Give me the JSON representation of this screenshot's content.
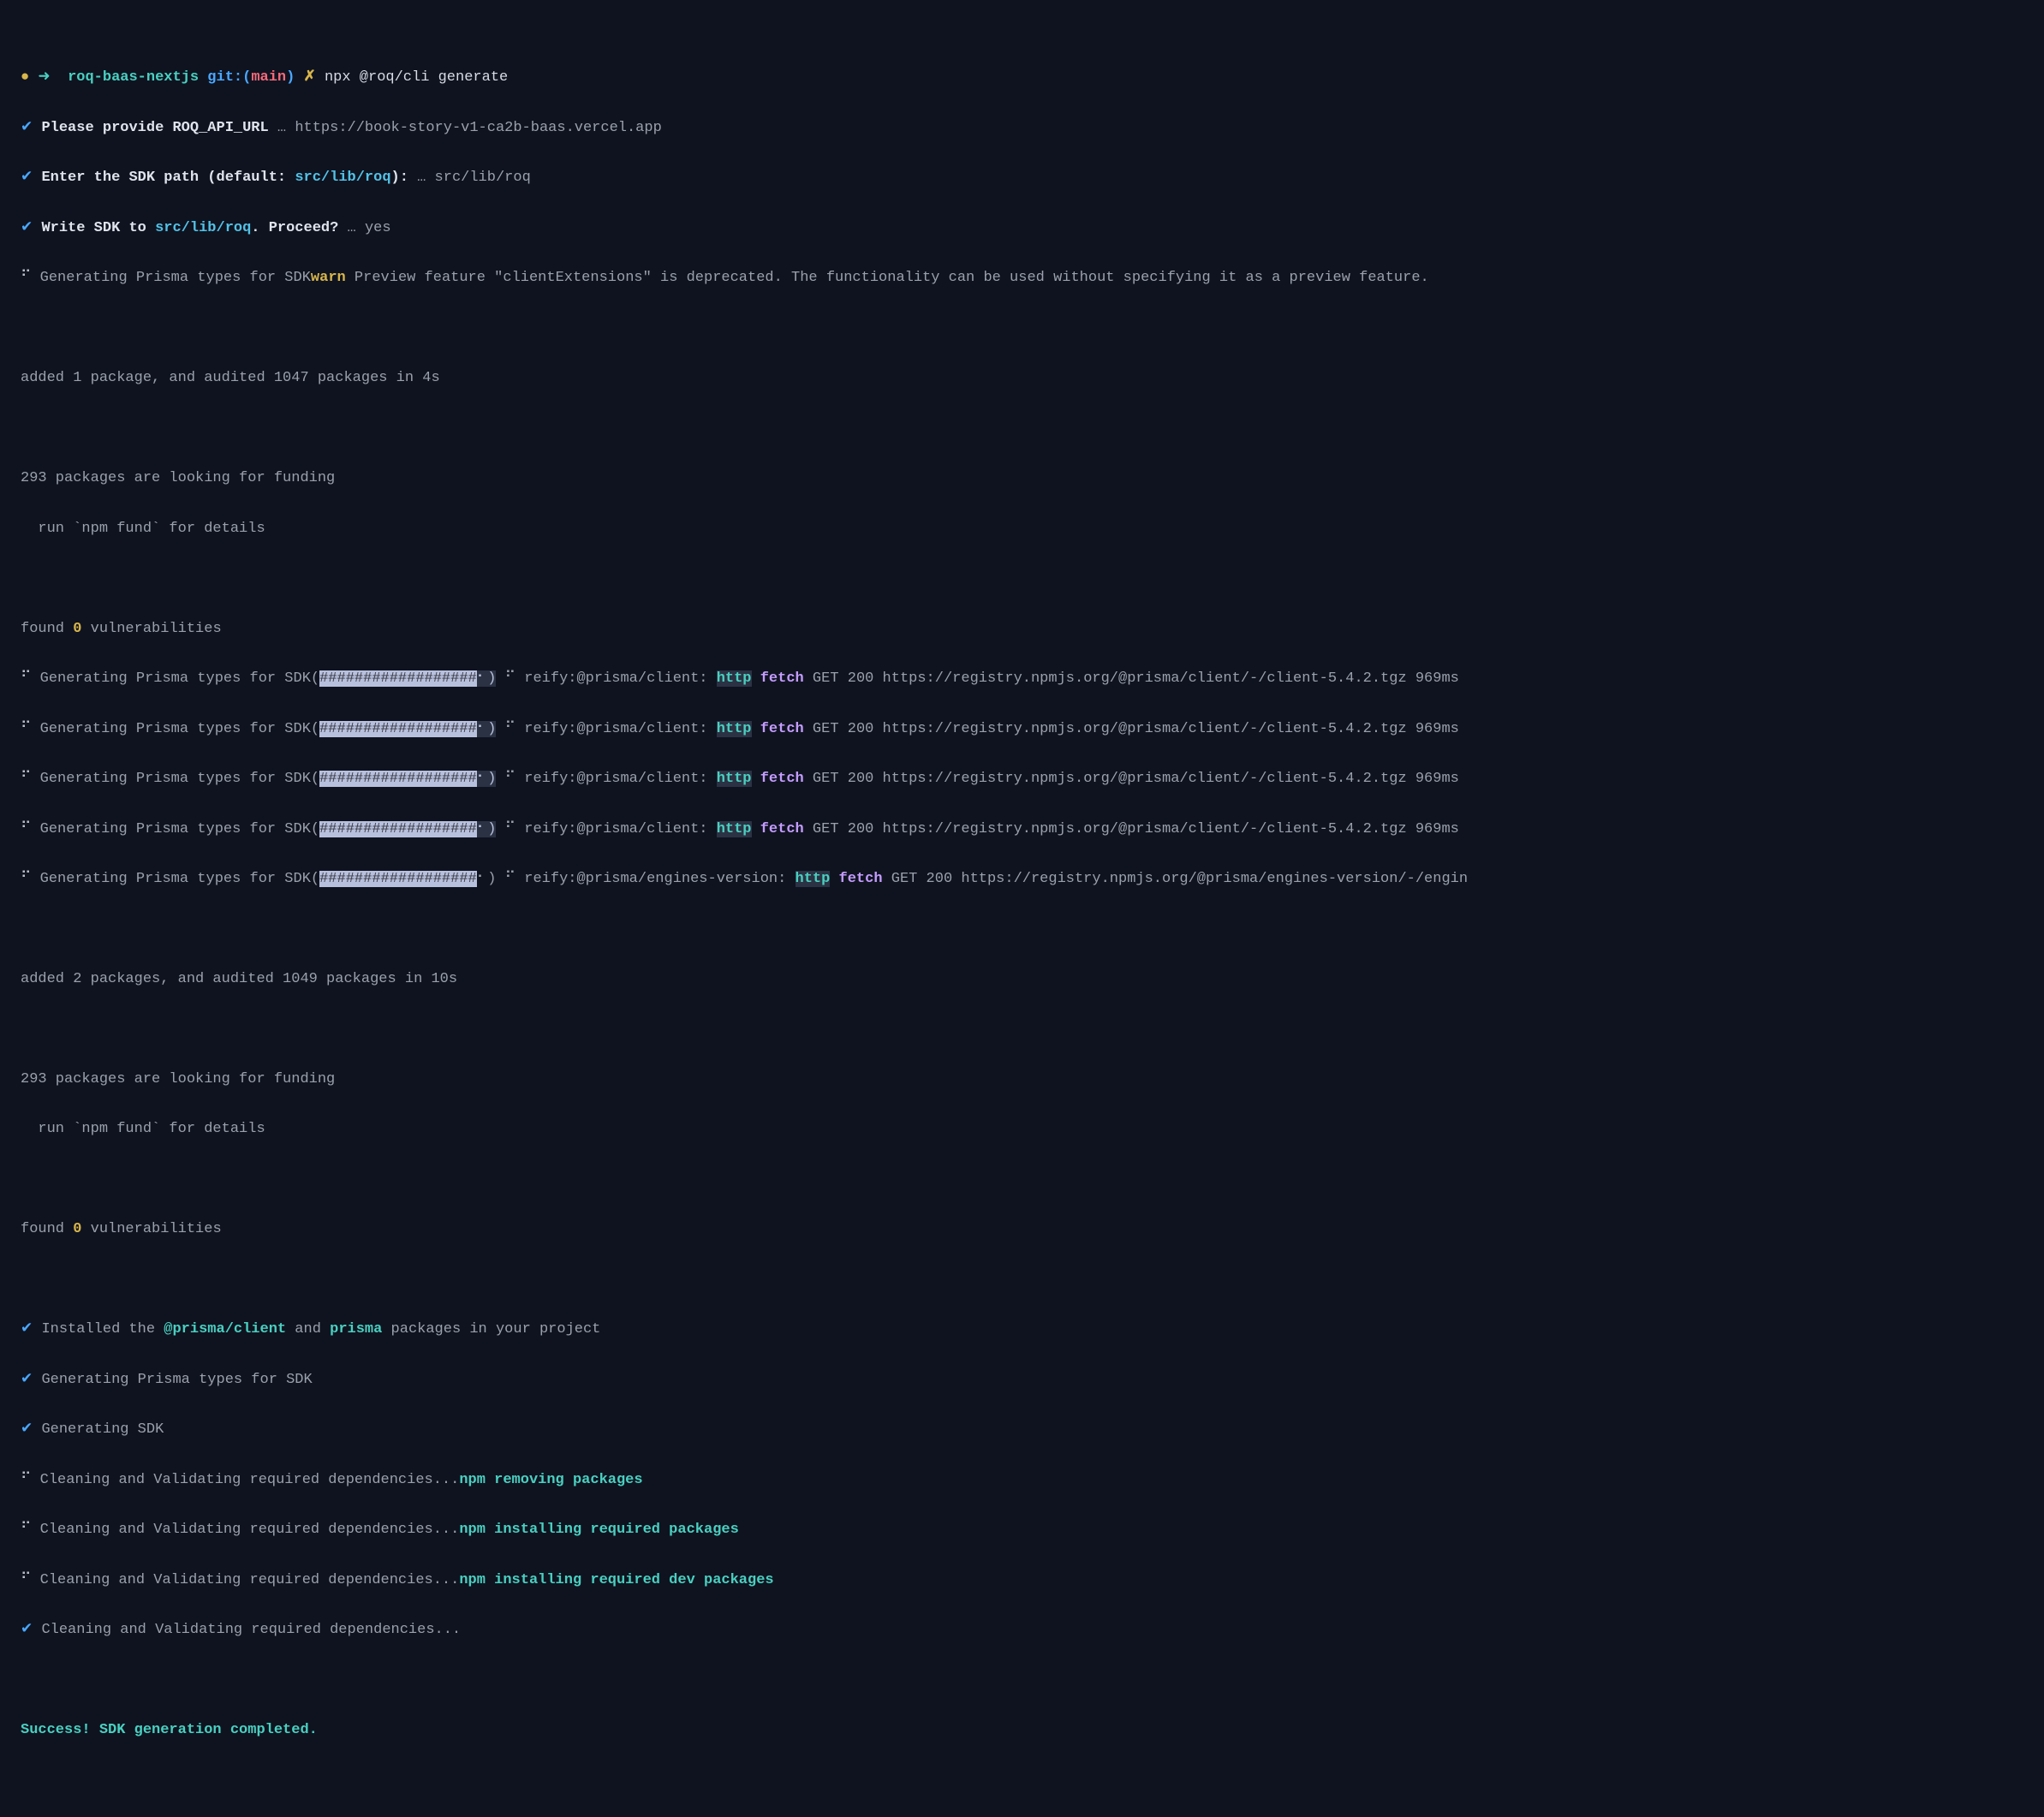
{
  "prompt": {
    "dot": "●",
    "arrow": "➜",
    "dir": "roq-baas-nextjs",
    "git": "git:",
    "lp": "(",
    "branch": "main",
    "rp": ")",
    "x": "✗",
    "cmd": "npx @roq/cli generate"
  },
  "q1": {
    "check": "✔",
    "label": "Please provide ROQ_API_URL",
    "sep": " … ",
    "val": "https://book-story-v1-ca2b-baas.vercel.app"
  },
  "q2": {
    "check": "✔",
    "label_a": "Enter the SDK path (default: ",
    "label_b": "src/lib/roq",
    "label_c": "):",
    "sep": " … ",
    "val": "src/lib/roq"
  },
  "q3": {
    "check": "✔",
    "label_a": "Write SDK to ",
    "label_b": "src/lib/roq",
    "label_c": ". Proceed?",
    "sep": " … ",
    "val": "yes"
  },
  "gen_warn": {
    "spin": "⠋",
    "a": "Generating Prisma types for SDK",
    "warn": "warn",
    "b": " Preview feature \"clientExtensions\" is deprecated. The functionality can be used without specifying it as a preview feature."
  },
  "npm1": {
    "added": "added 1 package, and audited 1047 packages in 4s",
    "fund1": "293 packages are looking for funding",
    "fund2": "  run `npm fund` for details",
    "vul_a": "found ",
    "vul_zero": "0",
    "vul_b": " vulnerabilities"
  },
  "reify": {
    "spin": "⠋",
    "prefix": "Generating Prisma types for SDK(",
    "bar": "##################",
    "bar_tail": "⠂)",
    "reify_client": " ⠋ reify:@prisma/client: ",
    "reify_engines": " ⠋ reify:@prisma/engines-version: ",
    "http": "http",
    "fetch": "fetch",
    "rest_client": " GET 200 https://registry.npmjs.org/@prisma/client/-/client-5.4.2.tgz 969ms",
    "rest_engines": " GET 200 https://registry.npmjs.org/@prisma/engines-version/-/engin"
  },
  "npm2": {
    "added": "added 2 packages, and audited 1049 packages in 10s",
    "fund1": "293 packages are looking for funding",
    "fund2": "  run `npm fund` for details",
    "vul_a": "found ",
    "vul_zero": "0",
    "vul_b": " vulnerabilities"
  },
  "installed": {
    "check": "✔",
    "a": "Installed the ",
    "p1": "@prisma/client",
    "b": " and ",
    "p2": "prisma",
    "c": " packages in your project"
  },
  "done1": {
    "check": "✔",
    "t": "Generating Prisma types for SDK"
  },
  "done2": {
    "check": "✔",
    "t": "Generating SDK"
  },
  "clean": {
    "spin": "⠋",
    "prefix": "Cleaning and Validating required dependencies...",
    "s1": "npm removing packages",
    "s2": "npm installing required packages",
    "s3": "npm installing required dev packages",
    "check": "✔"
  },
  "success": "Success! SDK generation completed."
}
